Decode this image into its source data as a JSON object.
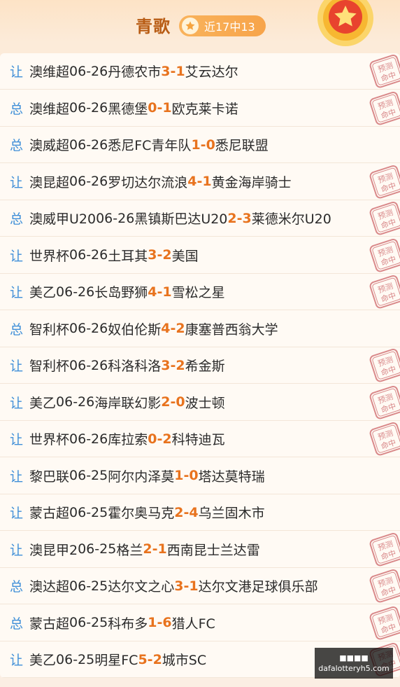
{
  "header": {
    "title": "青歌",
    "badge": "近17中13"
  },
  "stamp_text": [
    "预测",
    "命中"
  ],
  "rows": [
    {
      "tag": "让",
      "league": "澳维超",
      "date": "06-26",
      "home": "丹德农市",
      "hs": "3",
      "as": "1",
      "away": "艾云达尔",
      "hit": true
    },
    {
      "tag": "总",
      "league": "澳维超",
      "date": "06-26",
      "home": "黑德堡",
      "hs": "0",
      "as": "1",
      "away": "欧克莱卡诺",
      "hit": true
    },
    {
      "tag": "总",
      "league": "澳威超",
      "date": "06-26",
      "home": "悉尼FC青年队",
      "hs": "1",
      "as": "0",
      "away": "悉尼联盟",
      "hit": false
    },
    {
      "tag": "让",
      "league": "澳昆超",
      "date": "06-26",
      "home": "罗切达尔流浪",
      "hs": "4",
      "as": "1",
      "away": "黄金海岸骑士",
      "hit": true
    },
    {
      "tag": "总",
      "league": "澳威甲U20",
      "date": "06-26",
      "home": "黑镇斯巴达U20",
      "hs": "2",
      "as": "3",
      "away": "莱德米尔U20",
      "hit": true
    },
    {
      "tag": "让",
      "league": "世界杯",
      "date": "06-26",
      "home": "土耳其",
      "hs": "3",
      "as": "2",
      "away": "美国",
      "hit": true
    },
    {
      "tag": "让",
      "league": "美乙",
      "date": "06-26",
      "home": "长岛野狮",
      "hs": "4",
      "as": "1",
      "away": "雪松之星",
      "hit": true
    },
    {
      "tag": "总",
      "league": "智利杯",
      "date": "06-26",
      "home": "奴伯伦斯",
      "hs": "4",
      "as": "2",
      "away": "康塞普西翁大学",
      "hit": false
    },
    {
      "tag": "让",
      "league": "智利杯",
      "date": "06-26",
      "home": "科洛科洛",
      "hs": "3",
      "as": "2",
      "away": "希金斯",
      "hit": true
    },
    {
      "tag": "让",
      "league": "美乙",
      "date": "06-26",
      "home": "海岸联幻影",
      "hs": "2",
      "as": "0",
      "away": "波士顿",
      "hit": true
    },
    {
      "tag": "让",
      "league": "世界杯",
      "date": "06-26",
      "home": "库拉索",
      "hs": "0",
      "as": "2",
      "away": "科特迪瓦",
      "hit": true
    },
    {
      "tag": "让",
      "league": "黎巴联",
      "date": "06-25",
      "home": "阿尔内泽莫",
      "hs": "1",
      "as": "0",
      "away": "塔达莫特瑞",
      "hit": false
    },
    {
      "tag": "让",
      "league": "蒙古超",
      "date": "06-25",
      "home": "霍尔奥马克",
      "hs": "2",
      "as": "4",
      "away": "乌兰固木市",
      "hit": false
    },
    {
      "tag": "让",
      "league": "澳昆甲2",
      "date": "06-25",
      "home": "格兰",
      "hs": "2",
      "as": "1",
      "away": "西南昆士兰达雷",
      "hit": true
    },
    {
      "tag": "总",
      "league": "澳达超",
      "date": "06-25",
      "home": "达尔文之心",
      "hs": "3",
      "as": "1",
      "away": "达尔文港足球俱乐部",
      "hit": true
    },
    {
      "tag": "总",
      "league": "蒙古超",
      "date": "06-25",
      "home": "科布多",
      "hs": "1",
      "as": "6",
      "away": "猎人FC",
      "hit": true
    },
    {
      "tag": "让",
      "league": "美乙",
      "date": "06-25",
      "home": "明星FC",
      "hs": "5",
      "as": "2",
      "away": "城市SC",
      "hit": true
    }
  ],
  "watermark": {
    "line1": "■■■■",
    "line2": "dafalotteryh5.com"
  },
  "colors": {
    "tag": "#3f8fd8",
    "score": "#e8731e",
    "title": "#b85c14",
    "stamp": "#d9898a"
  }
}
